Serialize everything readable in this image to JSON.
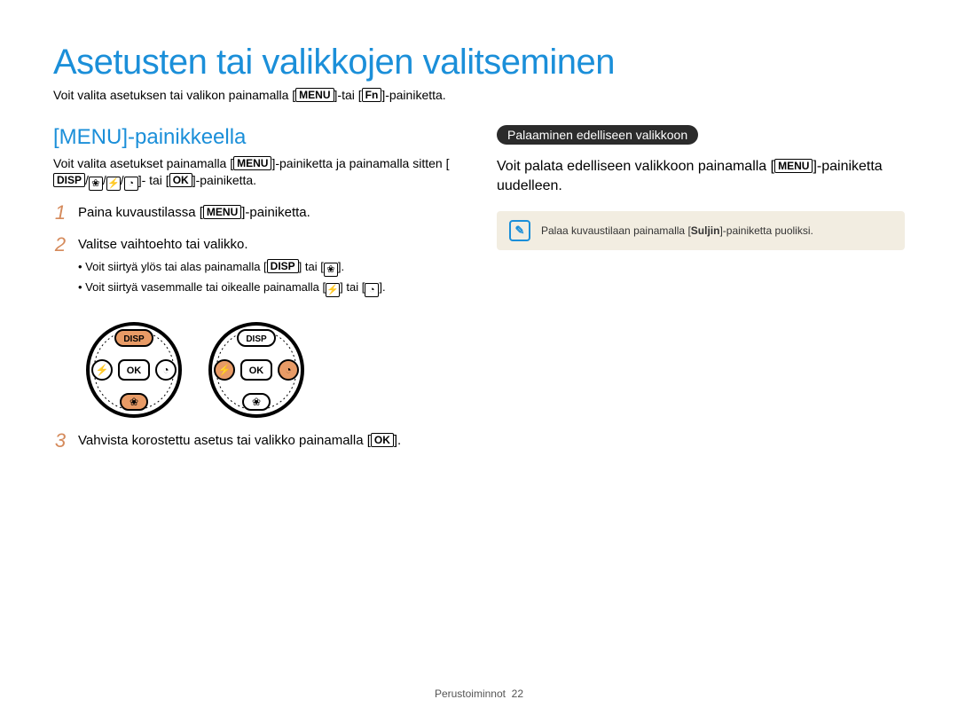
{
  "title": "Asetusten tai valikkojen valitseminen",
  "intro": {
    "pre": "Voit valita asetuksen tai valikon painamalla [",
    "menu": "MENU",
    "mid": "]-tai [",
    "fn": "Fn",
    "post": "]-painiketta."
  },
  "left": {
    "heading": "[MENU]-painikkeella",
    "para": {
      "pre": "Voit valita asetukset painamalla [",
      "menu": "MENU",
      "mid1": "]-painiketta ja painamalla sitten [",
      "disp": "DISP",
      "sep": "/",
      "mid2": "]- tai [",
      "ok": "OK",
      "post": "]-painiketta."
    },
    "step1": {
      "num": "1",
      "pre": "Paina kuvaustilassa [",
      "menu": "MENU",
      "post": "]-painiketta."
    },
    "step2": {
      "num": "2",
      "text": "Valitse vaihtoehto tai valikko.",
      "b1": {
        "pre": "Voit siirtyä ylös tai alas painamalla [",
        "disp": "DISP",
        "mid": "] tai [",
        "post": "]."
      },
      "b2": {
        "pre": "Voit siirtyä vasemmalle tai oikealle painamalla [",
        "mid": "] tai [",
        "post": "]."
      }
    },
    "step3": {
      "num": "3",
      "pre": "Vahvista korostettu asetus tai valikko painamalla [",
      "ok": "OK",
      "post": "]."
    },
    "dial_labels": {
      "disp": "DISP",
      "ok": "OK"
    }
  },
  "right": {
    "pill": "Palaaminen edelliseen valikkoon",
    "para": {
      "pre": "Voit palata edelliseen valikkoon painamalla [",
      "menu": "MENU",
      "post": "]-painiketta uudelleen."
    },
    "note": {
      "pre": "Palaa kuvaustilaan painamalla [",
      "bold": "Suljin",
      "post": "]-painiketta puoliksi."
    }
  },
  "footer": {
    "section": "Perustoiminnot",
    "page": "22"
  }
}
